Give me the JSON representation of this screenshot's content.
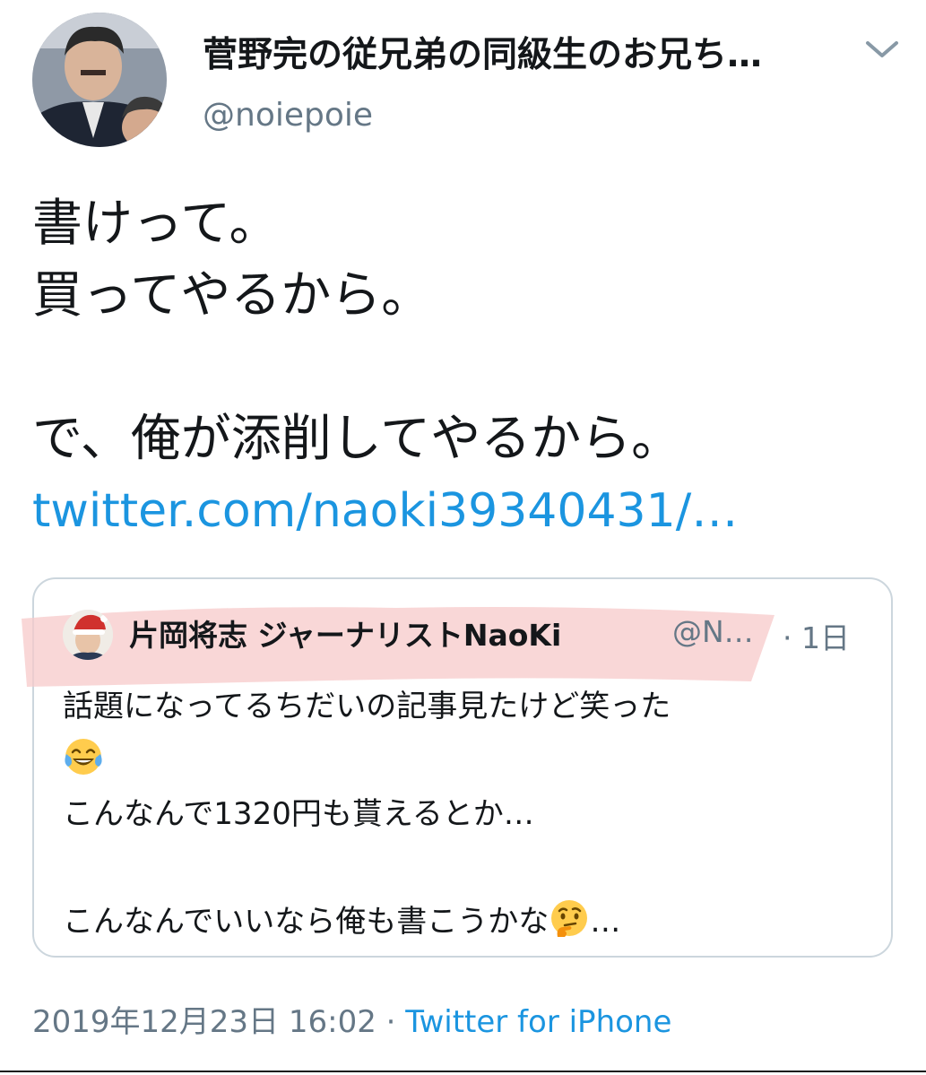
{
  "author": {
    "display_name": "菅野完の従兄弟の同級生のお兄ち…",
    "handle": "@noiepoie",
    "avatar_icon": "profile-photo"
  },
  "tweet": {
    "lines": [
      "書けって。",
      "買ってやるから。",
      "",
      "で、俺が添削してやるから。"
    ],
    "link": "twitter.com/naoki39340431/…"
  },
  "quoted_tweet": {
    "display_name": "片岡将志 ジャーナリストNaoKi",
    "handle": "@N…",
    "time": "· 1日",
    "lines": [
      "話題になってるちだいの記事見たけど笑った",
      "",
      "こんなんで1320円も貰えるとか…",
      "",
      "こんなんでいいなら俺も書こうかな",
      "…"
    ],
    "emojis": [
      "face-with-tears-of-joy-emoji",
      "thinking-face-emoji"
    ]
  },
  "footer": {
    "timestamp": "2019年12月23日 16:02",
    "separator": "·",
    "source": "Twitter for iPhone"
  },
  "colors": {
    "link": "#1b95e0",
    "secondary_text": "#657786",
    "highlight": "#f7c9c9",
    "border": "#ccd6dd"
  }
}
